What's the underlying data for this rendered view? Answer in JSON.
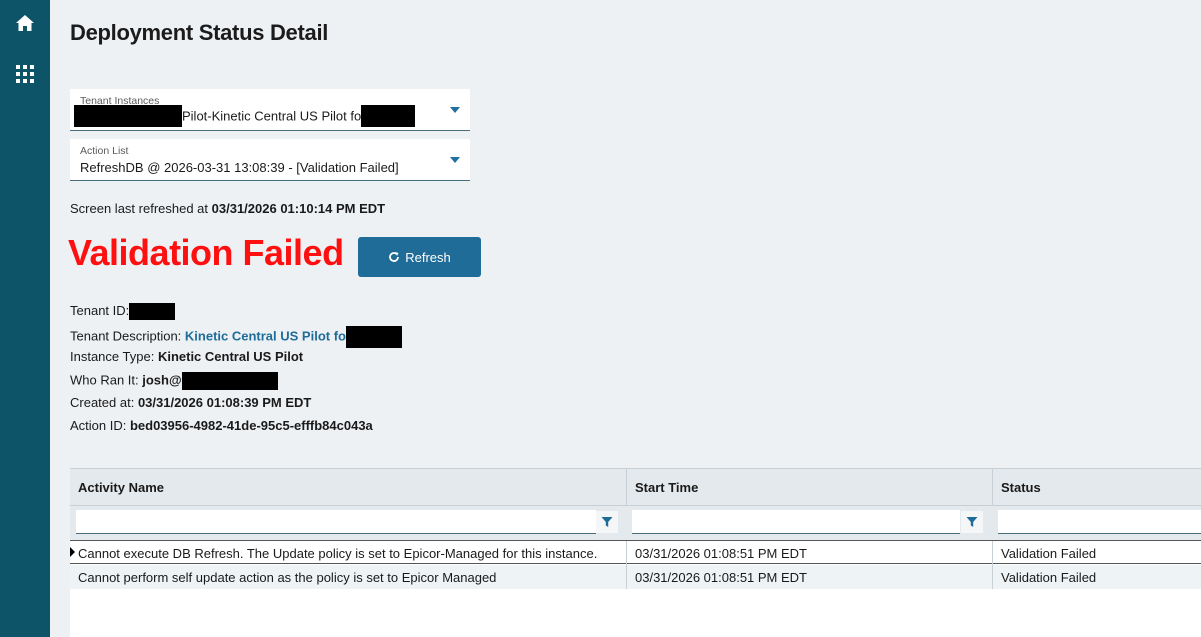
{
  "sidebar": {
    "icons": [
      "home-icon",
      "apps-grid-icon"
    ]
  },
  "page": {
    "title": "Deployment Status Detail"
  },
  "tenant_dropdown": {
    "label": "Tenant Instances",
    "value": "Pilot-Kinetic Central US Pilot fo"
  },
  "action_dropdown": {
    "label": "Action List",
    "value": "RefreshDB @ 2026-03-31 13:08:39 - [Validation Failed]"
  },
  "refreshed": {
    "prefix": "Screen last refreshed at ",
    "time": "03/31/2026 01:10:14 PM EDT"
  },
  "status": {
    "text": "Validation Failed",
    "color": "#ff1010"
  },
  "refresh_button": {
    "label": "Refresh"
  },
  "info": {
    "tenant_id_label": "Tenant ID:",
    "tenant_desc_label": "Tenant Description: ",
    "tenant_desc_value": "Kinetic Central US Pilot fo",
    "instance_type_label": "Instance Type: ",
    "instance_type_value": "Kinetic Central US Pilot",
    "who_ran_label": "Who Ran It: ",
    "who_ran_value": "josh@",
    "created_label": "Created at: ",
    "created_value": "03/31/2026 01:08:39 PM EDT",
    "action_id_label": "Action ID: ",
    "action_id_value": "bed03956-4982-41de-95c5-efffb84c043a"
  },
  "grid": {
    "columns": [
      "Activity Name",
      "Start Time",
      "Status"
    ],
    "rows": [
      [
        "Cannot execute DB Refresh. The Update policy is set to Epicor-Managed for this instance.",
        "03/31/2026 01:08:51 PM EDT",
        "Validation Failed"
      ],
      [
        "Cannot perform self update action as the policy is set to Epicor Managed",
        "03/31/2026 01:08:51 PM EDT",
        "Validation Failed"
      ]
    ]
  },
  "colors": {
    "sidebar": "#0d5468",
    "accent": "#1f6c98"
  }
}
